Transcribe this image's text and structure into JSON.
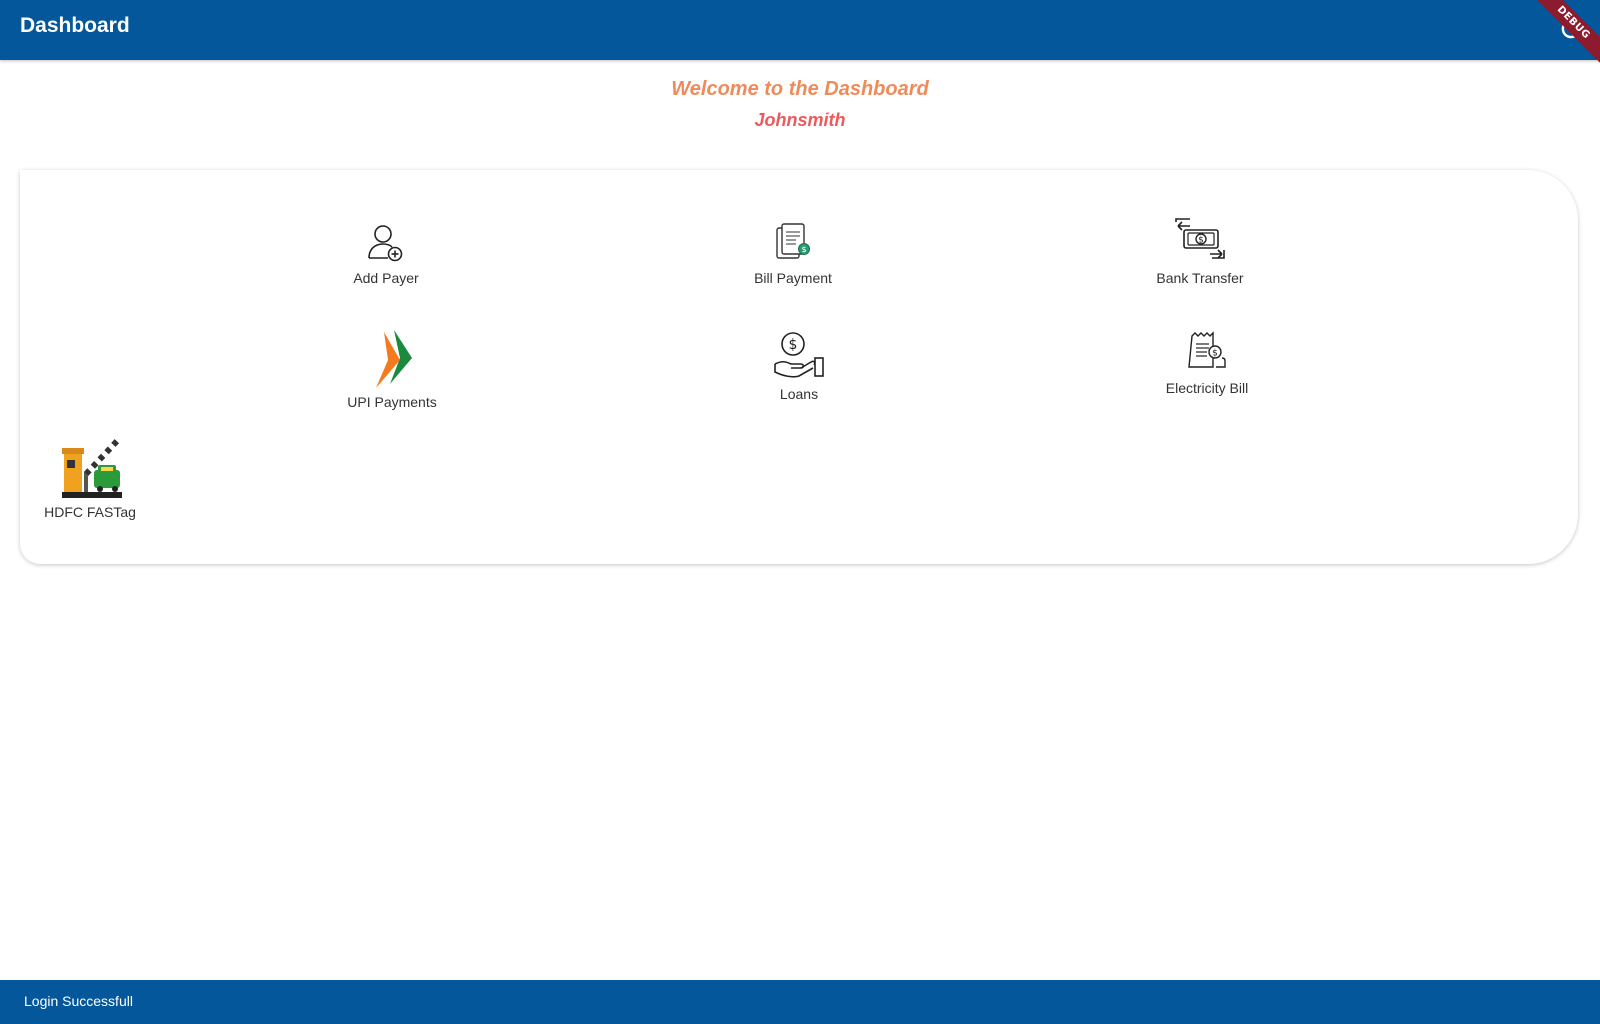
{
  "appbar": {
    "title": "Dashboard",
    "power_icon": "power-icon",
    "debug_banner": "DEBUG"
  },
  "welcome": {
    "heading": "Welcome to the Dashboard",
    "username": "Johnsmith"
  },
  "tiles": [
    {
      "label": "Add Payer",
      "icon": "add-user-icon"
    },
    {
      "label": "Bill Payment",
      "icon": "bill-icon"
    },
    {
      "label": "Bank Transfer",
      "icon": "money-transfer-icon"
    },
    {
      "label": "UPI Payments",
      "icon": "upi-logo-icon"
    },
    {
      "label": "Loans",
      "icon": "hand-coin-icon"
    },
    {
      "label": "Electricity Bill",
      "icon": "receipt-icon"
    },
    {
      "label": "HDFC FASTag",
      "icon": "toll-booth-icon"
    }
  ],
  "snackbar": {
    "message": "Login Successfull"
  },
  "colors": {
    "primary": "#03579a",
    "welcome": "#ef8a5a",
    "username": "#ec5b5b",
    "debug": "#8c1b2f"
  }
}
